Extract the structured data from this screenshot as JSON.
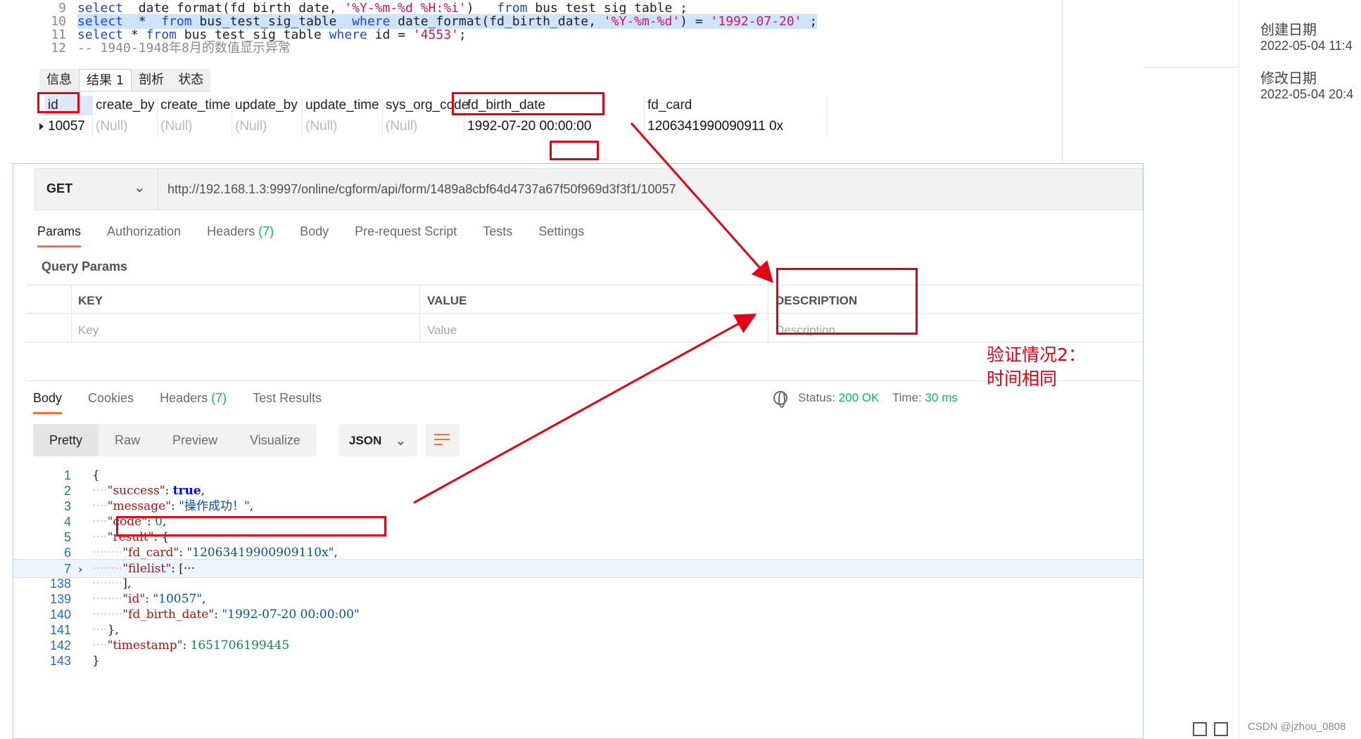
{
  "sql_editor": {
    "lines": [
      {
        "num": "9",
        "parts": [
          {
            "c": "kw",
            "t": "select"
          },
          {
            "c": "",
            "t": "  date_format(fd_birth_date, "
          },
          {
            "c": "str",
            "t": "'%Y-%m-%d %H:%i'"
          },
          {
            "c": "",
            "t": ")   "
          },
          {
            "c": "kw",
            "t": "from"
          },
          {
            "c": "",
            "t": " bus_test_sig_table ;"
          }
        ]
      },
      {
        "num": "10",
        "hl": true,
        "parts": [
          {
            "c": "kw",
            "t": "select"
          },
          {
            "c": "",
            "t": "  *  "
          },
          {
            "c": "kw",
            "t": "from"
          },
          {
            "c": "",
            "t": " bus_test_sig_table  "
          },
          {
            "c": "kw",
            "t": "where"
          },
          {
            "c": "",
            "t": " date_format(fd_birth_date, "
          },
          {
            "c": "str",
            "t": "'%Y-%m-%d'"
          },
          {
            "c": "",
            "t": ") = "
          },
          {
            "c": "str",
            "t": "'1992-07-20'"
          },
          {
            "c": "",
            "t": " ;"
          }
        ]
      },
      {
        "num": "11",
        "parts": [
          {
            "c": "kw",
            "t": "select"
          },
          {
            "c": "",
            "t": " * "
          },
          {
            "c": "kw",
            "t": "from"
          },
          {
            "c": "",
            "t": " bus_test_sig_table "
          },
          {
            "c": "kw",
            "t": "where"
          },
          {
            "c": "",
            "t": " id = "
          },
          {
            "c": "str",
            "t": "'4553'"
          },
          {
            "c": "",
            "t": ";"
          }
        ]
      },
      {
        "num": "12",
        "parts": [
          {
            "c": "cm",
            "t": "-- 1940-1948年8月的数值显示异常"
          }
        ]
      }
    ]
  },
  "result_tabs": [
    "信息",
    "结果 1",
    "剖析",
    "状态"
  ],
  "result_grid": {
    "columns": [
      "id",
      "create_by",
      "create_time",
      "update_by",
      "update_time",
      "sys_org_code",
      "fd_birth_date",
      "fd_card"
    ],
    "row": [
      "10057",
      "(Null)",
      "(Null)",
      "(Null)",
      "(Null)",
      "(Null)",
      "1992-07-20 00:00:00",
      "1206341990090911 0x"
    ]
  },
  "file_info": {
    "created_label": "创建日期",
    "created_value": "2022-05-04 11:4",
    "modified_label": "修改日期",
    "modified_value": "2022-05-04 20:4"
  },
  "request": {
    "method": "GET",
    "url_prefix": "http://192.168.1.3:9997/online/cgform/api/form/1489a8cbf64d4737a67f50f969d3f3f1/",
    "url_id": "10057",
    "tabs": [
      {
        "label": "Params",
        "active": true
      },
      {
        "label": "Authorization"
      },
      {
        "label": "Headers",
        "count": "(7)"
      },
      {
        "label": "Body"
      },
      {
        "label": "Pre-request Script"
      },
      {
        "label": "Tests"
      },
      {
        "label": "Settings"
      }
    ],
    "query_params_title": "Query Params",
    "params_headers": {
      "key": "KEY",
      "value": "VALUE",
      "description": "DESCRIPTION"
    },
    "params_placeholders": {
      "key": "Key",
      "value": "Value",
      "description": "Description"
    }
  },
  "response": {
    "tabs": [
      {
        "label": "Body",
        "active": true
      },
      {
        "label": "Cookies"
      },
      {
        "label": "Headers",
        "count": "(7)"
      },
      {
        "label": "Test Results"
      }
    ],
    "status_label": "Status:",
    "status_value": "200 OK",
    "time_label": "Time:",
    "time_value": "30 ms",
    "view_modes": [
      "Pretty",
      "Raw",
      "Preview",
      "Visualize"
    ],
    "format": "JSON",
    "body_lines": [
      {
        "num": "1",
        "indent": 0,
        "parts": [
          {
            "c": "",
            "t": "{"
          }
        ]
      },
      {
        "num": "2",
        "indent": 1,
        "parts": [
          {
            "c": "jk",
            "t": "\"success\""
          },
          {
            "c": "",
            "t": ": "
          },
          {
            "c": "jb",
            "t": "true"
          },
          {
            "c": "",
            "t": ","
          }
        ]
      },
      {
        "num": "3",
        "indent": 1,
        "parts": [
          {
            "c": "jk",
            "t": "\"message\""
          },
          {
            "c": "",
            "t": ": "
          },
          {
            "c": "js",
            "t": "\"操作成功！\""
          },
          {
            "c": "",
            "t": ","
          }
        ]
      },
      {
        "num": "4",
        "indent": 1,
        "parts": [
          {
            "c": "jk",
            "t": "\"code\""
          },
          {
            "c": "",
            "t": ": "
          },
          {
            "c": "jn",
            "t": "0"
          },
          {
            "c": "",
            "t": ","
          }
        ]
      },
      {
        "num": "5",
        "indent": 1,
        "parts": [
          {
            "c": "jk",
            "t": "\"result\""
          },
          {
            "c": "",
            "t": ": {"
          }
        ]
      },
      {
        "num": "6",
        "indent": 2,
        "parts": [
          {
            "c": "jk",
            "t": "\"fd_card\""
          },
          {
            "c": "",
            "t": ": "
          },
          {
            "c": "js",
            "t": "\"12063419900909110x\""
          },
          {
            "c": "",
            "t": ","
          }
        ]
      },
      {
        "num": "7",
        "indent": 2,
        "hl": true,
        "fold": true,
        "parts": [
          {
            "c": "jk",
            "t": "\"filelist\""
          },
          {
            "c": "",
            "t": ": [···"
          }
        ]
      },
      {
        "num": "138",
        "indent": 2,
        "parts": [
          {
            "c": "",
            "t": "],"
          }
        ]
      },
      {
        "num": "139",
        "indent": 2,
        "parts": [
          {
            "c": "jk",
            "t": "\"id\""
          },
          {
            "c": "",
            "t": ": "
          },
          {
            "c": "js",
            "t": "\"10057\""
          },
          {
            "c": "",
            "t": ","
          }
        ]
      },
      {
        "num": "140",
        "indent": 2,
        "parts": [
          {
            "c": "jk",
            "t": "\"fd_birth_date\""
          },
          {
            "c": "",
            "t": ": "
          },
          {
            "c": "js",
            "t": "\"1992-07-20 00:00:00\""
          }
        ]
      },
      {
        "num": "141",
        "indent": 1,
        "parts": [
          {
            "c": "",
            "t": "},"
          }
        ]
      },
      {
        "num": "142",
        "indent": 1,
        "parts": [
          {
            "c": "jk",
            "t": "\"timestamp\""
          },
          {
            "c": "",
            "t": ": "
          },
          {
            "c": "jn",
            "t": "1651706199445"
          }
        ]
      },
      {
        "num": "143",
        "indent": 0,
        "parts": [
          {
            "c": "",
            "t": "}"
          }
        ]
      }
    ]
  },
  "annotation": {
    "text": "验证情况2：\n时间相同",
    "color": "#e60012"
  },
  "watermark": "CSDN @jzhou_0808",
  "colors": {
    "accent": "#ff6c37",
    "success": "#0cbb52",
    "annotation": "#e60012"
  }
}
